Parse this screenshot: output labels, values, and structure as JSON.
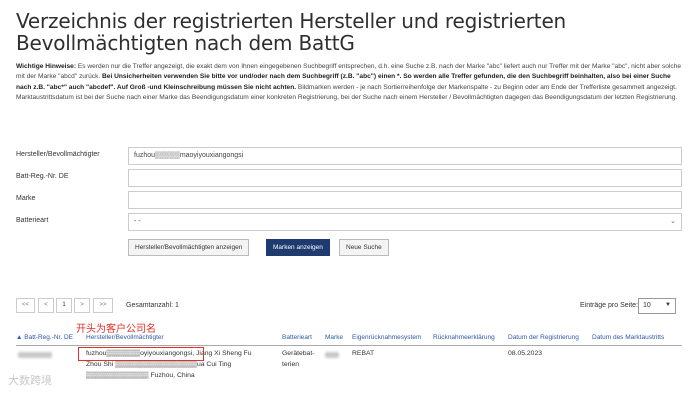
{
  "page": {
    "title": "Verzeichnis der registrierten Hersteller und registrierten Bevollmächtigten nach dem BattG"
  },
  "hints": {
    "label": "Wichtige Hinweise:",
    "text1": " Es werden nur die Treffer angezeigt, die exakt dem von Ihnen eingegebenen Suchbegriff entsprechen, d.h. eine Suche z.B. nach der Marke \"abc\" liefert auch nur Treffer mit der Marke \"abc\", nicht aber solche mit der Marke \"abcd\" zurück. ",
    "bold1": "Bei Unsicherheiten verwenden Sie bitte vor und/oder nach dem Suchbegriff (z.B. \"abc\") einen *. So werden alle Treffer gefunden, die den Suchbegriff beinhalten, also bei einer Suche nach z.B. \"abc*\" auch \"abcdef\". Auf Groß -und Kleinschreibung müssen Sie nicht achten.",
    "text2": " Bildmarken werden - je nach Sortierreihenfolge der Markenspalte - zu Beginn oder am Ende der Trefferliste gesammelt angezeigt. Marktaustrittsdatum ist bei der Suche nach einer Marke das Beendigungsdatum einer konkreten Registrierung, bei der Suche nach einem Hersteller / Bevollmächtigten dagegen das Beendigungsdatum der letzten Registrierung."
  },
  "form": {
    "fields": [
      {
        "label": "Hersteller/Bevollmächtigter",
        "value": "fuzhou▒▒▒▒▒maoyiyouxiangongsi"
      },
      {
        "label": "Batt-Reg.-Nr. DE",
        "value": ""
      },
      {
        "label": "Marke",
        "value": ""
      },
      {
        "label": "Batterieart",
        "value": "- -"
      }
    ],
    "buttons": {
      "show_makers": "Hersteller/Bevollmächtigten anzeigen",
      "show_brands": "Marken anzeigen",
      "new_search": "Neue Suche"
    }
  },
  "pager": {
    "first": "<<",
    "prev": "<",
    "page": "1",
    "next": ">",
    "last": ">>",
    "total": "Gesamtanzahl: 1",
    "per_page_label": "Einträge pro Seite:",
    "per_page_value": "10"
  },
  "annotation": "开头为客户公司名",
  "table": {
    "headers": [
      "▲ Batt-Reg.-Nr. DE",
      "Hersteller/Bevollmächtigter",
      "Batterieart",
      "Marke",
      "Eigenrücknahmesystem",
      "Rücknahmeerklärung",
      "Datum der Registrierung",
      "Datum des Marktaustritts"
    ],
    "row": {
      "maker_line1": "fuzhou▒▒▒▒▒▒▒oyiyouxiangongsi, Jiang Xi Sheng Fu",
      "maker_line2": "Zhou Shi ▒▒▒▒▒▒▒▒▒▒▒▒▒▒▒▒▒ua Cui Ting",
      "maker_line3": "▒▒▒▒▒▒▒▒▒▒▒▒▒ Fuzhou, China",
      "type_line1": "Gerätebat-",
      "type_line2": "terien",
      "system": "REBAT",
      "date": "08.05.2023"
    }
  },
  "watermark": "大数跨境"
}
